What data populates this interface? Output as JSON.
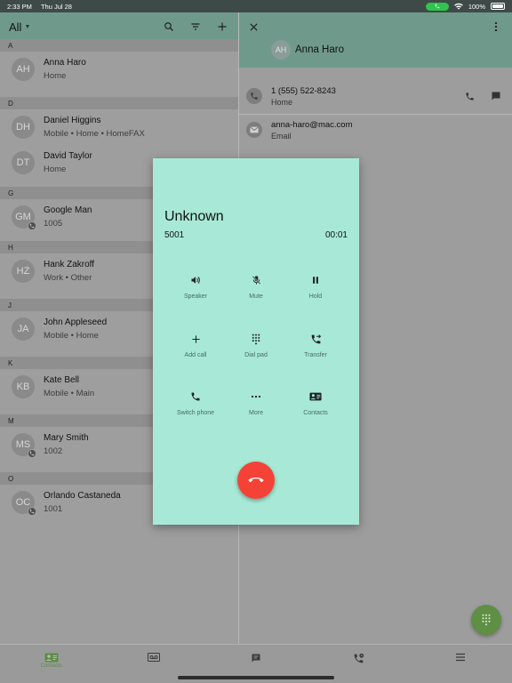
{
  "status_bar": {
    "time": "2:33 PM",
    "date": "Thu Jul 28",
    "battery": "100%"
  },
  "left_header": {
    "filter": "All"
  },
  "sections": [
    {
      "letter": "A",
      "contacts": [
        {
          "initials": "AH",
          "name": "Anna Haro",
          "sub": "Home",
          "badge": false
        }
      ]
    },
    {
      "letter": "D",
      "contacts": [
        {
          "initials": "DH",
          "name": "Daniel Higgins",
          "sub": "Mobile • Home • HomeFAX",
          "badge": false
        },
        {
          "initials": "DT",
          "name": "David Taylor",
          "sub": "Home",
          "badge": false
        }
      ]
    },
    {
      "letter": "G",
      "contacts": [
        {
          "initials": "GM",
          "name": "Google Man",
          "sub": "1005",
          "badge": true
        }
      ]
    },
    {
      "letter": "H",
      "contacts": [
        {
          "initials": "HZ",
          "name": "Hank Zakroff",
          "sub": "Work • Other",
          "badge": false
        }
      ]
    },
    {
      "letter": "J",
      "contacts": [
        {
          "initials": "JA",
          "name": "John Appleseed",
          "sub": "Mobile • Home",
          "badge": false
        }
      ]
    },
    {
      "letter": "K",
      "contacts": [
        {
          "initials": "KB",
          "name": "Kate Bell",
          "sub": "Mobile • Main",
          "badge": false
        }
      ]
    },
    {
      "letter": "M",
      "contacts": [
        {
          "initials": "MS",
          "name": "Mary Smith",
          "sub": "1002",
          "badge": true
        }
      ]
    },
    {
      "letter": "O",
      "contacts": [
        {
          "initials": "OC",
          "name": "Orlando Castaneda",
          "sub": "1001",
          "badge": true
        }
      ]
    }
  ],
  "detail": {
    "initials": "AH",
    "name": "Anna Haro",
    "phone": "1 (555) 522-8243",
    "phone_type": "Home",
    "email": "anna-haro@mac.com",
    "email_type": "Email"
  },
  "call": {
    "name": "Unknown",
    "number": "5001",
    "timer": "00:01",
    "controls": {
      "speaker": "Speaker",
      "mute": "Mute",
      "hold": "Hold",
      "add_call": "Add call",
      "dial_pad": "Dial pad",
      "transfer": "Transfer",
      "switch_phone": "Switch phone",
      "more": "More",
      "contacts": "Contacts"
    }
  },
  "bottom_nav": {
    "contacts": "Contacts"
  },
  "colors": {
    "header_green": "#6f9a8b",
    "call_bg": "#a7e9d6",
    "hangup_red": "#f44336",
    "fab_green": "#5e8f45",
    "active_green": "#5f8a4b"
  }
}
